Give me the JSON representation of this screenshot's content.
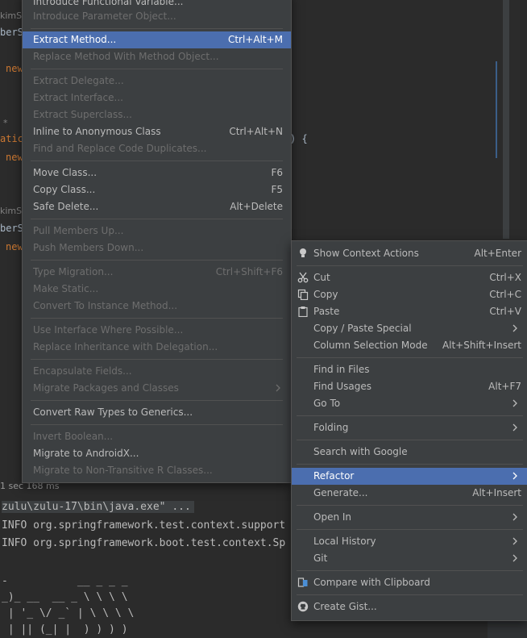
{
  "editor": {
    "frag1": "kimSc",
    "frag2": "berS",
    "frag3": "new",
    "frag4": "*",
    "frag5": "atic",
    "frag6": "new",
    "frag7": ") {",
    "frag8": "kimSc",
    "frag9": "berSe",
    "frag10": "new"
  },
  "status": {
    "time": "1 sec 168 ms"
  },
  "console": {
    "cmd": "zulu\\zulu-17\\bin\\java.exe\" ...",
    "line1": "INFO org.springframework.test.context.support",
    "line2": "INFO org.springframework.boot.test.context.Sp",
    "art1": "-           __ _ _ _",
    "art2": "_)_ __  __ _ \\ \\ \\ \\",
    "art3": " | '_ \\/ _` | \\ \\ \\ \\",
    "art4": " | || (_| |  ) ) ) )"
  },
  "refactor_menu": {
    "items": [
      {
        "label": "Introduce Functional Variable...",
        "shortcut": "",
        "disabled": false
      },
      {
        "label": "Introduce Parameter Object...",
        "shortcut": "",
        "disabled": true
      },
      {
        "label": "Extract Method...",
        "shortcut": "Ctrl+Alt+M",
        "disabled": false
      },
      {
        "label": "Replace Method With Method Object...",
        "shortcut": "",
        "disabled": true
      },
      {
        "label": "Extract Delegate...",
        "shortcut": "",
        "disabled": true
      },
      {
        "label": "Extract Interface...",
        "shortcut": "",
        "disabled": true
      },
      {
        "label": "Extract Superclass...",
        "shortcut": "",
        "disabled": true
      },
      {
        "label": "Inline to Anonymous Class",
        "shortcut": "Ctrl+Alt+N",
        "disabled": false
      },
      {
        "label": "Find and Replace Code Duplicates...",
        "shortcut": "",
        "disabled": true
      },
      {
        "label": "Move Class...",
        "shortcut": "F6",
        "disabled": false
      },
      {
        "label": "Copy Class...",
        "shortcut": "F5",
        "disabled": false
      },
      {
        "label": "Safe Delete...",
        "shortcut": "Alt+Delete",
        "disabled": false
      },
      {
        "label": "Pull Members Up...",
        "shortcut": "",
        "disabled": true
      },
      {
        "label": "Push Members Down...",
        "shortcut": "",
        "disabled": true
      },
      {
        "label": "Type Migration...",
        "shortcut": "Ctrl+Shift+F6",
        "disabled": true
      },
      {
        "label": "Make Static...",
        "shortcut": "",
        "disabled": true
      },
      {
        "label": "Convert To Instance Method...",
        "shortcut": "",
        "disabled": true
      },
      {
        "label": "Use Interface Where Possible...",
        "shortcut": "",
        "disabled": true
      },
      {
        "label": "Replace Inheritance with Delegation...",
        "shortcut": "",
        "disabled": true
      },
      {
        "label": "Encapsulate Fields...",
        "shortcut": "",
        "disabled": true
      },
      {
        "label": "Migrate Packages and Classes",
        "shortcut": "",
        "disabled": true
      },
      {
        "label": "Convert Raw Types to Generics...",
        "shortcut": "",
        "disabled": false
      },
      {
        "label": "Invert Boolean...",
        "shortcut": "",
        "disabled": true
      },
      {
        "label": "Migrate to AndroidX...",
        "shortcut": "",
        "disabled": false
      },
      {
        "label": "Migrate to Non-Transitive R Classes...",
        "shortcut": "",
        "disabled": true
      }
    ]
  },
  "context_menu": {
    "items": [
      {
        "label": "Show Context Actions",
        "shortcut": "Alt+Enter",
        "icon": "bulb-icon"
      },
      {
        "label": "Cut",
        "shortcut": "Ctrl+X",
        "icon": "scissors-icon"
      },
      {
        "label": "Copy",
        "shortcut": "Ctrl+C",
        "icon": "copy-icon"
      },
      {
        "label": "Paste",
        "shortcut": "Ctrl+V",
        "icon": "clipboard-icon"
      },
      {
        "label": "Copy / Paste Special",
        "shortcut": ""
      },
      {
        "label": "Column Selection Mode",
        "shortcut": "Alt+Shift+Insert"
      },
      {
        "label": "Find in Files",
        "shortcut": ""
      },
      {
        "label": "Find Usages",
        "shortcut": "Alt+F7"
      },
      {
        "label": "Go To",
        "shortcut": ""
      },
      {
        "label": "Folding",
        "shortcut": ""
      },
      {
        "label": "Search with Google",
        "shortcut": ""
      },
      {
        "label": "Refactor",
        "shortcut": ""
      },
      {
        "label": "Generate...",
        "shortcut": "Alt+Insert"
      },
      {
        "label": "Open In",
        "shortcut": ""
      },
      {
        "label": "Local History",
        "shortcut": ""
      },
      {
        "label": "Git",
        "shortcut": ""
      },
      {
        "label": "Compare with Clipboard",
        "shortcut": "",
        "icon": "compare-icon"
      },
      {
        "label": "Create Gist...",
        "shortcut": "",
        "icon": "github-icon"
      }
    ]
  },
  "colors": {
    "menu_bg": "#3c3f41",
    "selection": "#4b6eaf",
    "editor_bg": "#2b2b2b",
    "keyword": "#cc7832"
  }
}
